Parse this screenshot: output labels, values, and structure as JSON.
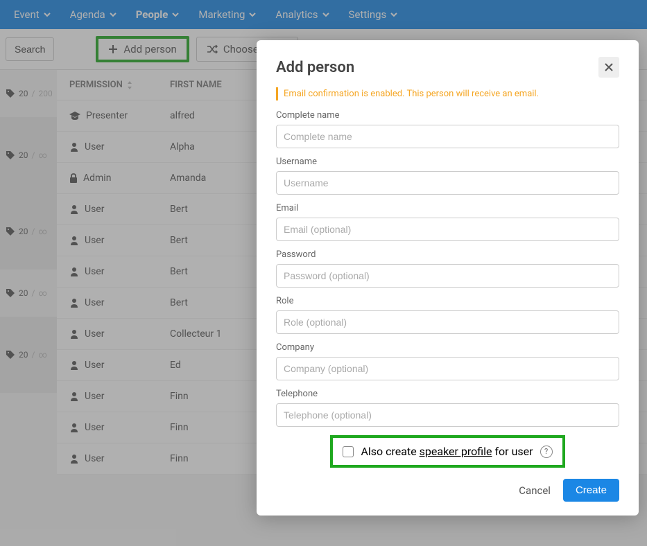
{
  "nav": {
    "items": [
      {
        "label": "Event"
      },
      {
        "label": "Agenda"
      },
      {
        "label": "People"
      },
      {
        "label": "Marketing"
      },
      {
        "label": "Analytics"
      },
      {
        "label": "Settings"
      }
    ]
  },
  "toolbar": {
    "search": "Search",
    "add_person": "Add person",
    "choose_random": "Choose rando"
  },
  "sidebar_tags": [
    {
      "count": "20",
      "limit": "200"
    },
    {
      "count": "20",
      "limit": "∞"
    },
    {
      "count": "20",
      "limit": "∞"
    },
    {
      "count": "20",
      "limit": "∞"
    },
    {
      "count": "20",
      "limit": "∞"
    }
  ],
  "table": {
    "headers": {
      "permission": "PERMISSION",
      "first_name": "FIRST NAME"
    },
    "rows": [
      {
        "perm_icon": "grad",
        "perm": "Presenter",
        "first": "alfred"
      },
      {
        "perm_icon": "user",
        "perm": "User",
        "first": "Alpha"
      },
      {
        "perm_icon": "lock",
        "perm": "Admin",
        "first": "Amanda"
      },
      {
        "perm_icon": "user",
        "perm": "User",
        "first": "Bert"
      },
      {
        "perm_icon": "user",
        "perm": "User",
        "first": "Bert"
      },
      {
        "perm_icon": "user",
        "perm": "User",
        "first": "Bert"
      },
      {
        "perm_icon": "user",
        "perm": "User",
        "first": "Bert"
      },
      {
        "perm_icon": "user",
        "perm": "User",
        "first": "Collecteur 1"
      },
      {
        "perm_icon": "user",
        "perm": "User",
        "first": "Ed"
      },
      {
        "perm_icon": "user",
        "perm": "User",
        "first": "Finn"
      },
      {
        "perm_icon": "user",
        "perm": "User",
        "first": "Finn"
      },
      {
        "perm_icon": "user",
        "perm": "User",
        "first": "Finn"
      }
    ]
  },
  "modal": {
    "title": "Add person",
    "notice": "Email confirmation is enabled. This person will receive an email.",
    "fields": {
      "name": {
        "label": "Complete name",
        "placeholder": "Complete name"
      },
      "username": {
        "label": "Username",
        "placeholder": "Username"
      },
      "email": {
        "label": "Email",
        "placeholder": "Email (optional)"
      },
      "password": {
        "label": "Password",
        "placeholder": "Password (optional)"
      },
      "role": {
        "label": "Role",
        "placeholder": "Role (optional)"
      },
      "company": {
        "label": "Company",
        "placeholder": "Company (optional)"
      },
      "telephone": {
        "label": "Telephone",
        "placeholder": "Telephone (optional)"
      }
    },
    "checkbox": {
      "pre": "Also create ",
      "link": "speaker profile",
      "post": " for user"
    },
    "cancel": "Cancel",
    "create": "Create"
  }
}
